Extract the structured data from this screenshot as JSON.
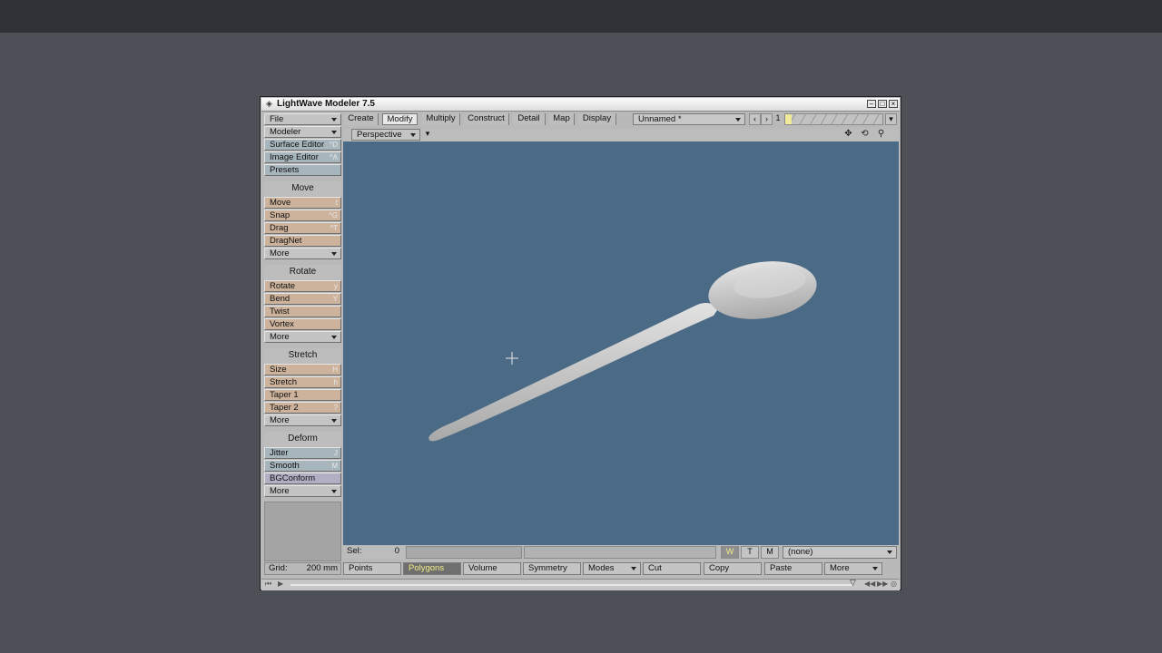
{
  "window": {
    "title": "LightWave Modeler 7.5"
  },
  "left_panel": {
    "file": "File",
    "modeler": "Modeler",
    "surface_editor": {
      "label": "Surface Editor",
      "key": "^D"
    },
    "image_editor": {
      "label": "Image Editor",
      "key": "^A"
    },
    "presets": "Presets",
    "sections": [
      {
        "title": "Move",
        "items": [
          {
            "label": "Move",
            "key": "t"
          },
          {
            "label": "Snap",
            "key": "^G"
          },
          {
            "label": "Drag",
            "key": "^T"
          },
          {
            "label": "DragNet",
            "key": ""
          }
        ],
        "more": "More"
      },
      {
        "title": "Rotate",
        "items": [
          {
            "label": "Rotate",
            "key": "y"
          },
          {
            "label": "Bend",
            "key": "Y"
          },
          {
            "label": "Twist",
            "key": ""
          },
          {
            "label": "Vortex",
            "key": ""
          }
        ],
        "more": "More"
      },
      {
        "title": "Stretch",
        "items": [
          {
            "label": "Size",
            "key": "H"
          },
          {
            "label": "Stretch",
            "key": "h"
          },
          {
            "label": "Taper 1",
            "key": ""
          },
          {
            "label": "Taper 2",
            "key": "?"
          }
        ],
        "more": "More"
      },
      {
        "title": "Deform",
        "items": [
          {
            "label": "Jitter",
            "key": "J"
          },
          {
            "label": "Smooth",
            "key": "M"
          },
          {
            "label": "BGConform",
            "key": ""
          }
        ],
        "more": "More"
      }
    ]
  },
  "tabs": [
    "Create",
    "Modify",
    "Multiply",
    "Construct",
    "Detail",
    "Map",
    "Display"
  ],
  "active_tab": "Modify",
  "object_select": "Unnamed *",
  "layer_number": "1",
  "view": {
    "mode": "Perspective"
  },
  "status": {
    "sel_label": "Sel:",
    "sel_value": "0",
    "w": "W",
    "t": "T",
    "m": "M",
    "surface": "(none)",
    "grid_label": "Grid:",
    "grid_value": "200 mm"
  },
  "bottom_buttons": {
    "points": "Points",
    "polygons": "Polygons",
    "volume": "Volume",
    "symmetry": "Symmetry",
    "modes": "Modes",
    "cut": "Cut",
    "copy": "Copy",
    "paste": "Paste",
    "more": "More"
  },
  "colors": {
    "viewport": "#4a6a86",
    "spoon": "#c9c9c9",
    "active_text": "#f2ea8a"
  }
}
